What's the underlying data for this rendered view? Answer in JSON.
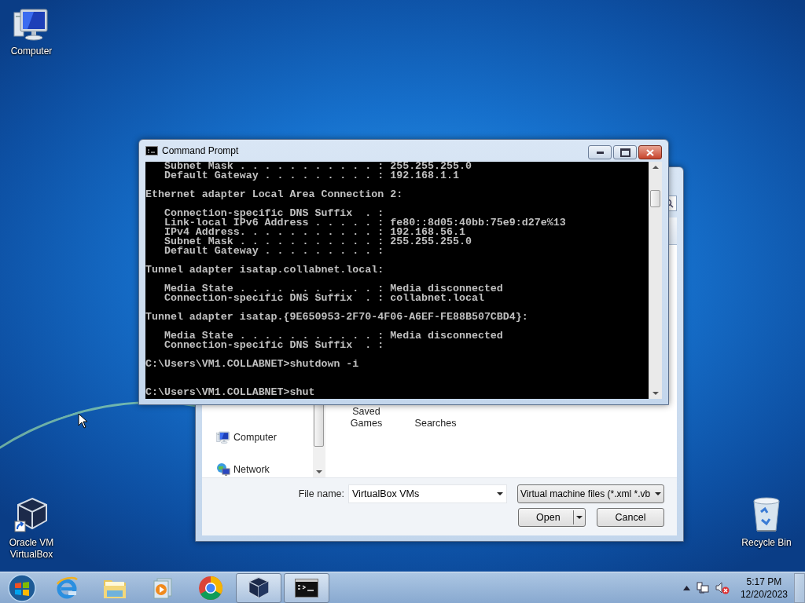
{
  "desktop": {
    "icons": [
      {
        "kind": "computer",
        "label": "Computer"
      },
      {
        "kind": "cube",
        "label": "Oracle VM VirtualBox"
      },
      {
        "kind": "recycle-bin",
        "label": "Recycle Bin"
      }
    ]
  },
  "file_dialog": {
    "nav_items": [
      {
        "kind": "computer",
        "label": "Computer"
      },
      {
        "kind": "network",
        "label": "Network"
      }
    ],
    "items": [
      {
        "label": "Saved Games"
      },
      {
        "label": "Searches"
      }
    ],
    "file_name_label": "File name:",
    "file_name": "VirtualBox VMs",
    "file_type": "Virtual machine files (*.xml *.vb",
    "open_button": "Open",
    "cancel_button": "Cancel"
  },
  "command_prompt": {
    "title": "Command Prompt",
    "lines": [
      {
        "kind": "text",
        "text": "   Subnet Mask . . . . . . . . . . . : 255.255.255.0"
      },
      {
        "kind": "text",
        "text": "   Default Gateway . . . . . . . . . : 192.168.1.1"
      },
      {
        "kind": "blank"
      },
      {
        "kind": "text",
        "text": "Ethernet adapter Local Area Connection 2:"
      },
      {
        "kind": "blank"
      },
      {
        "kind": "text",
        "text": "   Connection-specific DNS Suffix  . :"
      },
      {
        "kind": "text",
        "text": "   Link-local IPv6 Address . . . . . : fe80::8d05:40bb:75e9:d27e%13"
      },
      {
        "kind": "text",
        "text": "   IPv4 Address. . . . . . . . . . . : 192.168.56.1"
      },
      {
        "kind": "text",
        "text": "   Subnet Mask . . . . . . . . . . . : 255.255.255.0"
      },
      {
        "kind": "text",
        "text": "   Default Gateway . . . . . . . . . :"
      },
      {
        "kind": "blank"
      },
      {
        "kind": "text",
        "text": "Tunnel adapter isatap.collabnet.local:"
      },
      {
        "kind": "blank"
      },
      {
        "kind": "text",
        "text": "   Media State . . . . . . . . . . . : Media disconnected"
      },
      {
        "kind": "text",
        "text": "   Connection-specific DNS Suffix  . : collabnet.local"
      },
      {
        "kind": "blank"
      },
      {
        "kind": "text",
        "text": "Tunnel adapter isatap.{9E650953-2F70-4F06-A6EF-FE88B507CBD4}:"
      },
      {
        "kind": "blank"
      },
      {
        "kind": "text",
        "text": "   Media State . . . . . . . . . . . : Media disconnected"
      },
      {
        "kind": "text",
        "text": "   Connection-specific DNS Suffix  . :"
      },
      {
        "kind": "blank"
      },
      {
        "kind": "text",
        "text": "C:\\Users\\VM1.COLLABNET>shutdown -i"
      },
      {
        "kind": "blank"
      },
      {
        "kind": "blank"
      },
      {
        "kind": "text",
        "text": "C:\\Users\\VM1.COLLABNET>shut"
      }
    ]
  },
  "taskbar": {
    "apps": [
      {
        "kind": "e-browser",
        "active": false
      },
      {
        "kind": "folder",
        "active": false
      },
      {
        "kind": "media-player",
        "active": false
      },
      {
        "kind": "round-browser",
        "active": false
      },
      {
        "kind": "cube",
        "active": true
      },
      {
        "kind": "terminal",
        "active": true
      }
    ],
    "clock": {
      "time": "5:17 PM",
      "date": "12/20/2023"
    }
  }
}
